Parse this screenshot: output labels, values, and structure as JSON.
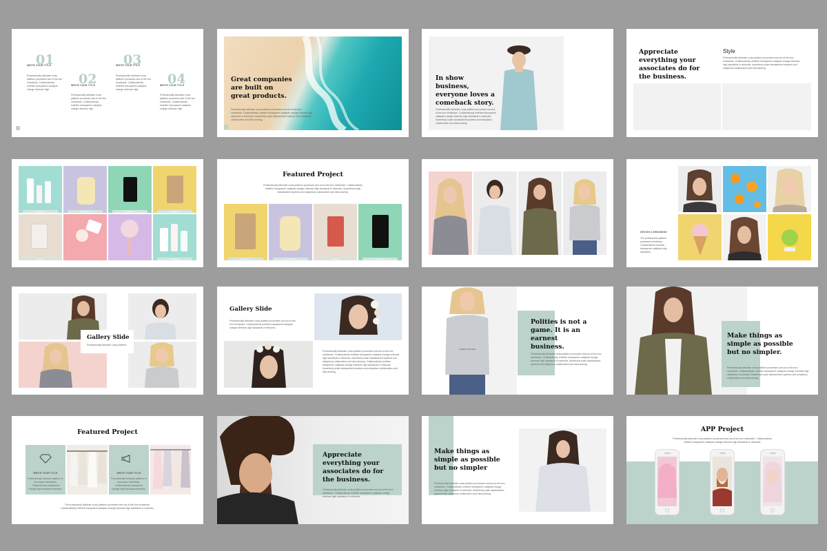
{
  "slides": {
    "s1": {
      "items": [
        {
          "num": "01",
          "title": "WRITE YOUR TITLE",
          "text": "Professionally fabricate cross platform processes and of the box mindshare. Collaboratively redefine transparent catalysts change whereas high."
        },
        {
          "num": "02",
          "title": "WRITE YOUR TITLE",
          "text": "Professionally fabricate cross platform processes and of the box mindshare. Collaboratively redefine transparent catalysts change whereas high."
        },
        {
          "num": "03",
          "title": "WRITE YOUR TITLE",
          "text": "Professionally fabricate cross platform processes and of the box mindshare. Collaboratively redefine transparent catalysts change whereas high."
        },
        {
          "num": "04",
          "title": "WRITE YOUR TITLE",
          "text": "Professionally fabricate cross platform processes and of the box mindshare. Collaboratively redefine transparent catalysts change whereas high."
        }
      ]
    },
    "s2": {
      "title": "Great companies are built on great products.",
      "text": "Professionally fabricate cross-platform processes and out-of-the-box mindshare. Collaboratively redefine transparent catalysts change whereas high standards in networks. Assertively scale standardized systems and ubiquitous collaboration and idea-sharing."
    },
    "s3": {
      "title": "In show business, everyone loves a comeback story.",
      "text": "Professionally fabricate cross-platform processes and out-of-the-box mindshare. Collaboratively redefine transparent catalysts change whereas high standards in networks. Assertively scale standardized systems and ubiquitous collaboration and idea-sharing."
    },
    "s4": {
      "title": "Appreciate everything your associates do for the business.",
      "subtitle": "Style",
      "text": "Professionally fabricate cross-platform processes and out-of-the-box mindshare. Collaboratively redefine transparent catalysts change whereas high standards in networks. Assertively scale standardized systems and ubiquitous collaboration and idea-sharing."
    },
    "s5": {
      "caption": "Product A"
    },
    "s6": {
      "title": "Featured Project",
      "text": "Professionally fabricate cross-platform processes and out-of-the-box mindshare. Collaboratively redefine transparent catalysts change whereas high standards in networks. Assertively scale standardized systems and ubiquitous collaboration and idea-sharing.",
      "caption": "Product A"
    },
    "s8": {
      "label": "DESIGN & BRANDING",
      "text": "The professional platform processes mindshare. Collaboratively redefine transparent catalysts high standards."
    },
    "s9": {
      "title": "Gallery Slide",
      "text": "Professionally fabricate cross-platform"
    },
    "s10": {
      "title": "Gallery Slide",
      "text": "Professionally fabricate cross-platform processes and out-of-the-box mindshare. Collaboratively redefine transparent catalysts change whereas high standards in networks.",
      "text2": "Professionally fabricate cross-platform processes and out-of-the-box mindshare. Collaboratively redefine transparent catalysts change whereas high standards in networks. Assertively scale standardized systems and ubiquitous collaboration and idea-sharing. Collaboratively redefine transparent catalysts change whereas high standards in networks. Assertively scale standardized systems and ubiquitous collaboration and idea-sharing."
    },
    "s11": {
      "title": "Polities is not a game. It is an earnest business.",
      "text": "Professionally fabricate cross-platform processes and out-of-the-box mindshare. Collaboratively redefine transparent catalysts change whereas high standards in networks. Assertively scale standardized systems and ubiquitous collaboration and idea-sharing.",
      "shirt": "CAMPUS UNICORN"
    },
    "s12": {
      "title": "Make things as simple as possible but no simpler.",
      "text": "Professionally fabricate cross-platform processes and out-of-the-box mindshare. Collaboratively redefine transparent catalysts change whereas high standards in networks. Assertively scale standardized systems and ubiquitous collaboration and idea-sharing."
    },
    "s13": {
      "title": "Featured Project",
      "items": [
        {
          "title": "WRITE YOUR TITLE",
          "text": "Professionally fabricate platform to processes mindshare. Collaboratively transparent change high standards networks."
        },
        {
          "title": "WRITE YOUR TITLE",
          "text": "Professionally fabricate platform to processes mindshare. Collaboratively transparent change high standards networks."
        }
      ],
      "footer": "The professional fabricate cross-platform processes and out-of-the-box mindshare. Collaboratively redefine transparent catalysts change whereas high standards in networks."
    },
    "s14": {
      "title": "Appreciate everything your associates do for the business.",
      "text": "Professionally fabricate cross-platform processes and out-of-the-box mindshare. Collaboratively redefine transparent catalysts change whereas high standards in networks."
    },
    "s15": {
      "title": "Make things as simple as possible but no simpler",
      "text": "Professionally fabricate cross-platform processes and out-of-the-box mindshare. Collaboratively redefine transparent catalysts change whereas high standards in networks. Assertively scale standardized systems and ubiquitous collaboration and idea-sharing."
    },
    "s16": {
      "title": "APP Project",
      "text": "Professionally fabricate cross-platform processes and out-of-the-box mindshare. Collaboratively redefine transparent catalysts change whereas high standards in networks."
    }
  },
  "colors": {
    "accent": "#bcd3cc",
    "background": "#9d9d9d",
    "slide": "#ffffff",
    "heading": "#111111"
  }
}
